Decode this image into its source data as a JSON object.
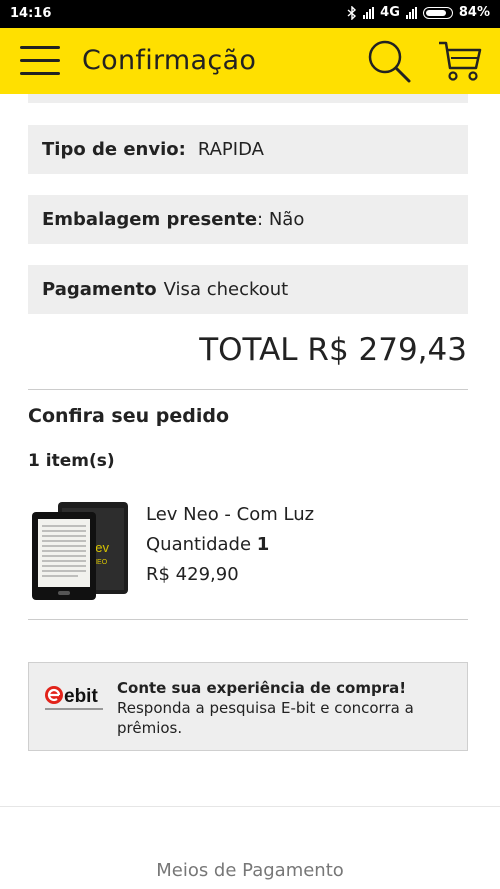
{
  "status_bar": {
    "time": "14:16",
    "network": "4G",
    "battery": "84%"
  },
  "header": {
    "title": "Confirmação",
    "icons": [
      "menu-icon",
      "search-icon",
      "cart-icon"
    ],
    "background": "#ffe000"
  },
  "order_info": {
    "shipping": {
      "label": "Tipo de envio:",
      "value": "RAPIDA"
    },
    "gift_wrap": {
      "label": "Embalagem presente",
      "value": ": Não"
    },
    "payment": {
      "label": "Pagamento",
      "value": "Visa checkout"
    }
  },
  "total": "TOTAL R$ 279,43",
  "review": {
    "title": "Confira seu pedido",
    "item_count": "1 item(s)",
    "items": [
      {
        "name": "Lev Neo - Com Luz",
        "quantity_label": "Quantidade",
        "quantity": "1",
        "price": "R$ 429,90"
      }
    ]
  },
  "ebit": {
    "logo_text": "ebit",
    "title": "Conte sua experiência de compra!",
    "text": "Responda a pesquisa E-bit e concorra a prêmios."
  },
  "footer": {
    "link": "Meios de Pagamento"
  }
}
